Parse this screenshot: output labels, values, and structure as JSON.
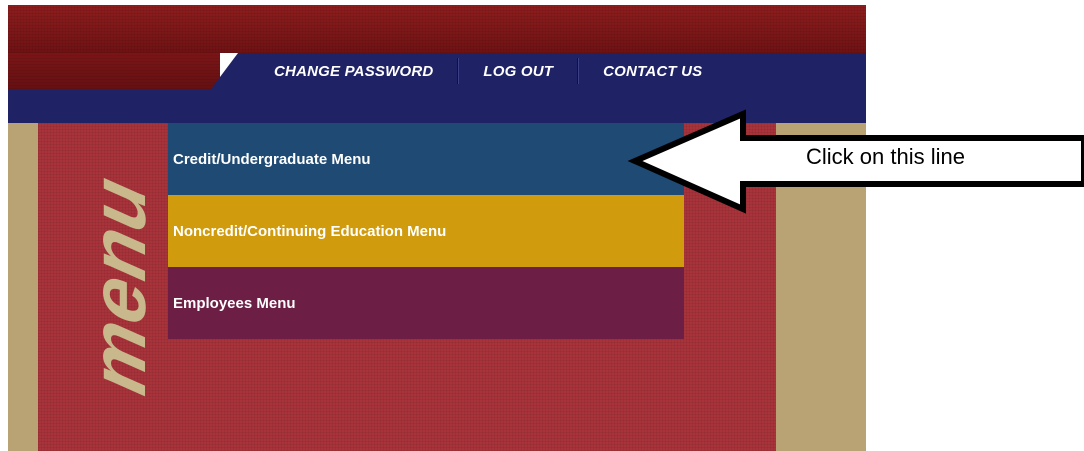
{
  "nav": {
    "items": [
      {
        "label": "Change Password"
      },
      {
        "label": "Log Out"
      },
      {
        "label": "Contact Us"
      }
    ]
  },
  "sidebar": {
    "title": "menu"
  },
  "menu": {
    "items": [
      {
        "label": "Credit/Undergraduate Menu",
        "color": "#1f4a73"
      },
      {
        "label": "Noncredit/Continuing Education Menu",
        "color": "#d09b0c"
      },
      {
        "label": "Employees Menu",
        "color": "#6c1e45"
      }
    ]
  },
  "callout": {
    "text": "Click on this line",
    "icon": "left-arrow-icon"
  },
  "colors": {
    "banner_red": "#8e1d1d",
    "nav_navy": "#1f2366",
    "tan": "#b9a274",
    "background_red": "#a8333b"
  }
}
